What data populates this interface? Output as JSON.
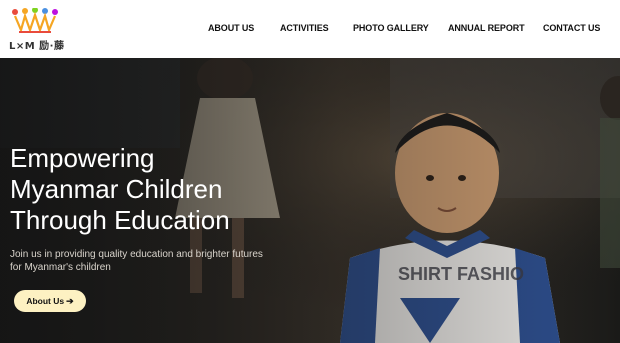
{
  "logo": {
    "text": "L×M 励·藤"
  },
  "nav": [
    {
      "label": "ABOUT US"
    },
    {
      "label": "ACTIVITIES"
    },
    {
      "label": "PHOTO GALLERY"
    },
    {
      "label": "ANNUAL REPORT"
    },
    {
      "label": "CONTACT US"
    }
  ],
  "hero": {
    "headline_lines": [
      "Empowering",
      "Myanmar Children",
      "Through Education"
    ],
    "subtext_lines": [
      "Join us in providing quality education and brighter futures",
      "for Myanmar's children"
    ],
    "cta_label": "About Us",
    "cta_icon": "arrow-right-icon"
  }
}
